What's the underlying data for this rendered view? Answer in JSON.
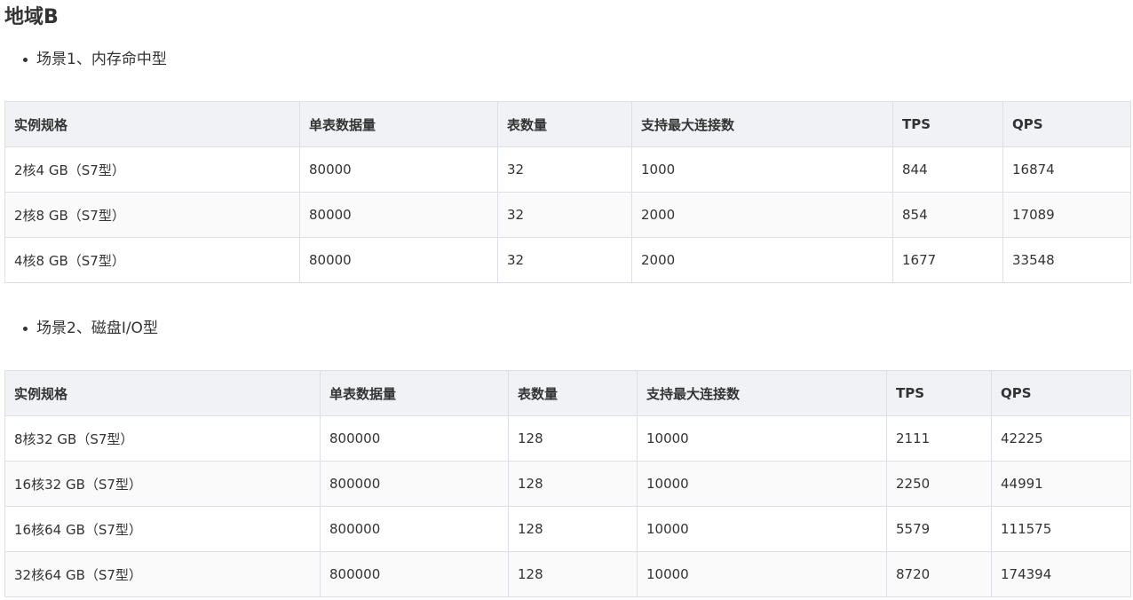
{
  "heading": "地域B",
  "scenario1": {
    "title": "场景1、内存命中型",
    "headers": [
      "实例规格",
      "单表数据量",
      "表数量",
      "支持最大连接数",
      "TPS",
      "QPS"
    ],
    "rows": [
      [
        "2核4 GB（S7型）",
        "80000",
        "32",
        "1000",
        "844",
        "16874"
      ],
      [
        "2核8 GB（S7型）",
        "80000",
        "32",
        "2000",
        "854",
        "17089"
      ],
      [
        "4核8 GB（S7型）",
        "80000",
        "32",
        "2000",
        "1677",
        "33548"
      ]
    ]
  },
  "scenario2": {
    "title": "场景2、磁盘I/O型",
    "headers": [
      "实例规格",
      "单表数据量",
      "表数量",
      "支持最大连接数",
      "TPS",
      "QPS"
    ],
    "rows": [
      [
        "8核32 GB（S7型）",
        "800000",
        "128",
        "10000",
        "2111",
        "42225"
      ],
      [
        "16核32 GB（S7型）",
        "800000",
        "128",
        "10000",
        "2250",
        "44991"
      ],
      [
        "16核64 GB（S7型）",
        "800000",
        "128",
        "10000",
        "5579",
        "111575"
      ],
      [
        "32核64 GB（S7型）",
        "800000",
        "128",
        "10000",
        "8720",
        "174394"
      ]
    ]
  }
}
